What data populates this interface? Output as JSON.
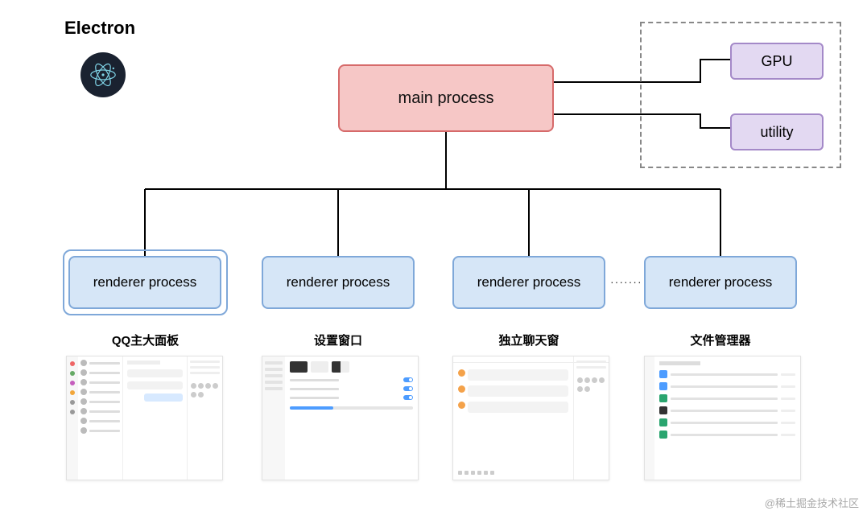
{
  "title": "Electron",
  "main_process": {
    "label": "main process"
  },
  "helpers": {
    "gpu": "GPU",
    "utility": "utility"
  },
  "renderers": [
    {
      "label": "renderer process",
      "caption": "QQ主大面板",
      "highlighted": true
    },
    {
      "label": "renderer process",
      "caption": "设置窗口",
      "highlighted": false
    },
    {
      "label": "renderer process",
      "caption": "独立聊天窗",
      "highlighted": false
    },
    {
      "label": "renderer process",
      "caption": "文件管理器",
      "highlighted": false
    }
  ],
  "ellipsis": "·······",
  "watermark": "@稀土掘金技术社区",
  "colors": {
    "main_bg": "#f6c7c6",
    "main_border": "#d66a6a",
    "renderer_bg": "#d6e6f7",
    "renderer_border": "#7fa8d9",
    "helper_bg": "#e3d9f2",
    "helper_border": "#a489c8"
  }
}
